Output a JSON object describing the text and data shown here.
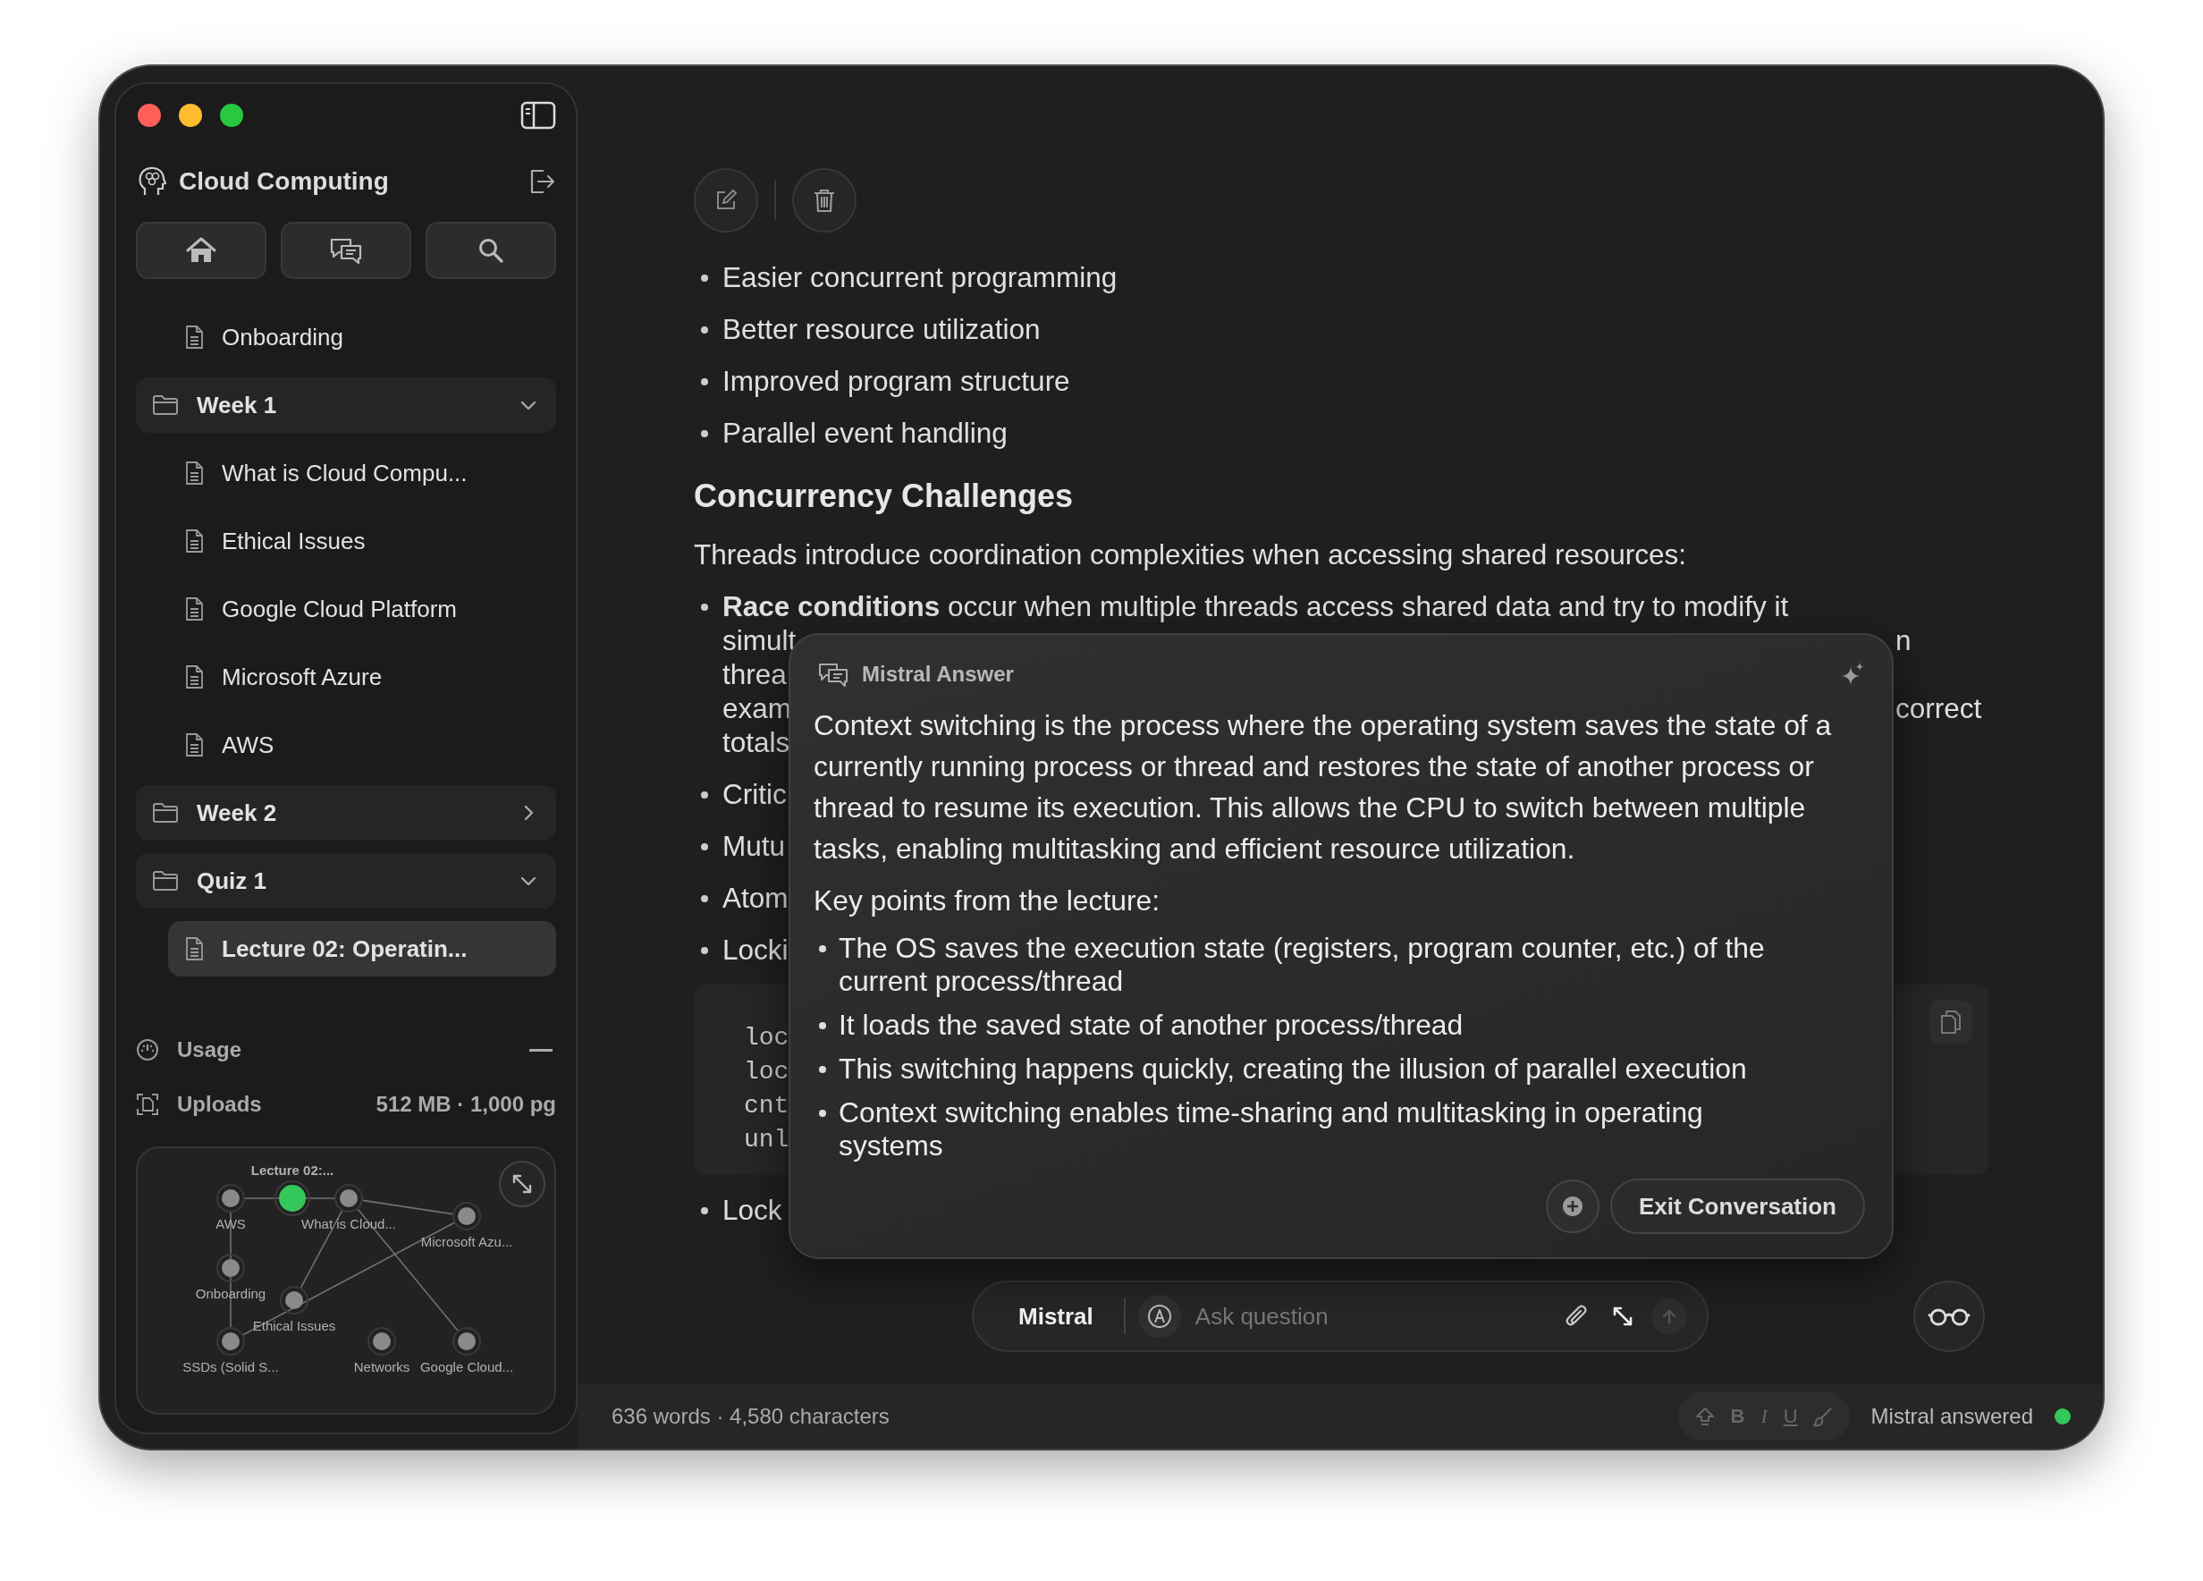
{
  "window": {
    "controls": [
      {
        "kind": "close"
      },
      {
        "kind": "minimize"
      },
      {
        "kind": "zoom"
      }
    ]
  },
  "sidebar": {
    "title": "Cloud Computing",
    "nav": [
      {
        "kind": "home"
      },
      {
        "kind": "chat"
      },
      {
        "kind": "search"
      }
    ],
    "tree": [
      {
        "kind": "file",
        "label": "Onboarding",
        "selected": false
      },
      {
        "kind": "folder",
        "label": "Week 1",
        "expanded": true,
        "selected": false,
        "children": [
          {
            "kind": "file",
            "label": "What is Cloud Compu...",
            "selected": false
          },
          {
            "kind": "file",
            "label": "Ethical Issues",
            "selected": false
          },
          {
            "kind": "file",
            "label": "Google Cloud Platform",
            "selected": false
          },
          {
            "kind": "file",
            "label": "Microsoft Azure",
            "selected": false
          },
          {
            "kind": "file",
            "label": "AWS",
            "selected": false
          }
        ]
      },
      {
        "kind": "folder",
        "label": "Week 2",
        "expanded": false,
        "selected": false
      },
      {
        "kind": "folder",
        "label": "Quiz 1",
        "expanded": true,
        "selected": false,
        "children": [
          {
            "kind": "file",
            "label": "Lecture 02: Operatin...",
            "selected": true
          }
        ]
      }
    ],
    "usage": {
      "label": "Usage"
    },
    "uploads": {
      "label": "Uploads",
      "value": "512 MB · 1,000 pg"
    },
    "graph": {
      "nodes": [
        {
          "label": "AWS",
          "selected": false
        },
        {
          "label": "Lecture 02:...",
          "selected": true
        },
        {
          "label": "What is Cloud...",
          "selected": false
        },
        {
          "label": "Microsoft Azu...",
          "selected": false
        },
        {
          "label": "Onboarding",
          "selected": false
        },
        {
          "label": "Ethical Issues",
          "selected": false
        },
        {
          "label": "SSDs (Solid S...",
          "selected": false
        },
        {
          "label": "Networks",
          "selected": false
        },
        {
          "label": "Google Cloud...",
          "selected": false
        }
      ]
    }
  },
  "document": {
    "items": [
      {
        "kind": "bullet",
        "lines": [
          {
            "left": "Easier concurrent programming"
          }
        ]
      },
      {
        "kind": "bullet",
        "lines": [
          {
            "left": "Better resource utilization"
          }
        ]
      },
      {
        "kind": "bullet",
        "lines": [
          {
            "left": "Improved program structure"
          }
        ]
      },
      {
        "kind": "bullet",
        "lines": [
          {
            "left": "Parallel event handling"
          }
        ]
      },
      {
        "kind": "heading",
        "text": "Concurrency Challenges"
      },
      {
        "kind": "paragraph",
        "text": "Threads introduce coordination complexities when accessing shared resources:"
      },
      {
        "kind": "bullet",
        "lines": [
          {
            "left": "**Race conditions** occur when multiple threads access shared data and try to modify it"
          },
          {
            "left": "simult",
            "right": "n"
          },
          {
            "left": "threa"
          },
          {
            "left": "exam",
            "right": "correct"
          },
          {
            "left": "totals"
          }
        ]
      },
      {
        "kind": "bullet",
        "lines": [
          {
            "left": "Critic"
          }
        ]
      },
      {
        "kind": "bullet",
        "lines": [
          {
            "left": "Mutu"
          }
        ]
      },
      {
        "kind": "bullet",
        "lines": [
          {
            "left": "Atom"
          }
        ]
      },
      {
        "kind": "bullet",
        "lines": [
          {
            "left": "Locki"
          }
        ]
      },
      {
        "kind": "code",
        "lines": [
          "loc",
          "loc",
          "cnt",
          "unl"
        ]
      },
      {
        "kind": "bullet",
        "lines": [
          {
            "left": "Lock"
          }
        ]
      }
    ]
  },
  "popup": {
    "title": "Mistral Answer",
    "paragraph": "Context switching is the process where the operating system saves the state of a currently running process or thread and restores the state of another process or thread to resume its execution. This allows the CPU to switch between multiple tasks, enabling multitasking and efficient resource utilization.",
    "subheading": "Key points from the lecture:",
    "points": [
      "The OS saves the execution state (registers, program counter, etc.) of the current process/thread",
      "It loads the saved state of another process/thread",
      "This switching happens quickly, creating the illusion of parallel execution",
      "Context switching enables time-sharing and multitasking in operating systems"
    ],
    "exit_label": "Exit Conversation"
  },
  "input": {
    "model": "Mistral",
    "placeholder": "Ask question"
  },
  "status_bar": {
    "counts": "636 words · 4,580 characters",
    "format": [
      {
        "kind": "icon"
      },
      {
        "kind": "bold",
        "label": "B"
      },
      {
        "kind": "italic",
        "label": "I"
      },
      {
        "kind": "underline",
        "label": "U"
      },
      {
        "kind": "brush"
      }
    ],
    "status": "Mistral answered",
    "online": true
  }
}
